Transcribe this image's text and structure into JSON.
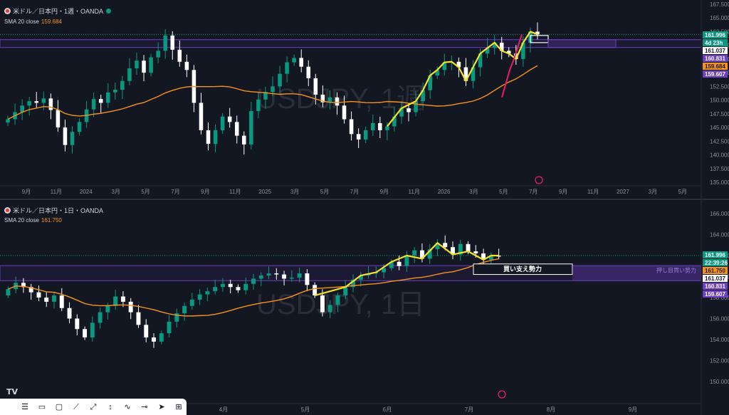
{
  "colors": {
    "bg": "#131722",
    "up": "#089981",
    "down": "#ffffff",
    "sma": "#f7931a",
    "trend": "#f5e02a",
    "pink": "#e91e63",
    "zone": "#6c3fc4",
    "axis_text": "#8a8f99"
  },
  "top": {
    "header": "米ドル／日本円・1週・OANDA",
    "sma_label": "SMA 20 close",
    "sma_value": "159.684",
    "watermark": "USDJPY, 1週",
    "y_ticks": [
      "167.500",
      "165.000",
      "162.500",
      "160.000",
      "157.500",
      "155.000",
      "152.500",
      "150.000",
      "147.500",
      "145.000",
      "142.500",
      "140.000",
      "137.500",
      "135.000"
    ],
    "x_ticks": [
      "9月",
      "11月",
      "2024",
      "3月",
      "5月",
      "7月",
      "9月",
      "11月",
      "2025",
      "3月",
      "5月",
      "7月",
      "9月",
      "11月",
      "2026",
      "3月",
      "5月",
      "7月",
      "9月",
      "11月",
      "2027",
      "3月",
      "5月"
    ],
    "price_tags": [
      {
        "text": "161.996",
        "bg": "#089981",
        "fg": "#ffffff"
      },
      {
        "text": "4d 23h",
        "bg": "#089981",
        "fg": "#ffffff"
      },
      {
        "text": "161.037",
        "bg": "#ffffff",
        "fg": "#131722"
      },
      {
        "text": "160.831",
        "bg": "#6c3fc4",
        "fg": "#ffffff"
      },
      {
        "text": "159.684",
        "bg": "#f7931a",
        "fg": "#131722"
      },
      {
        "text": "159.607",
        "bg": "#6c3fc4",
        "fg": "#ffffff"
      }
    ]
  },
  "bottom": {
    "header": "米ドル／日本円・1日・OANDA",
    "sma_label": "SMA 20 close",
    "sma_value": "161.750",
    "watermark": "USDJPY, 1日",
    "y_ticks": [
      "166.000",
      "164.000",
      "162.000",
      "160.000",
      "158.000",
      "156.000",
      "154.000",
      "152.000",
      "150.000"
    ],
    "x_ticks": [
      "4月",
      "5月",
      "6月",
      "7月",
      "8月",
      "9月"
    ],
    "zone_label": "買い支え勢力",
    "zone_right_label": "押し目買い勢力",
    "price_tags": [
      {
        "text": "161.996",
        "bg": "#089981",
        "fg": "#ffffff"
      },
      {
        "text": "22:39:26",
        "bg": "#089981",
        "fg": "#ffffff"
      },
      {
        "text": "161.750",
        "bg": "#f7931a",
        "fg": "#131722"
      },
      {
        "text": "161.037",
        "bg": "#ffffff",
        "fg": "#131722"
      },
      {
        "text": "160.831",
        "bg": "#6c3fc4",
        "fg": "#ffffff"
      },
      {
        "text": "159.607",
        "bg": "#6c3fc4",
        "fg": "#ffffff"
      }
    ]
  },
  "toolbar": {
    "icons": [
      "lines-icon",
      "text-icon",
      "rectangle-icon",
      "trendline-icon",
      "ruler-icon",
      "path-icon",
      "fib-icon",
      "brush-icon",
      "arrow-icon",
      "cursor-icon",
      "more-icon"
    ]
  },
  "chart_data": [
    {
      "type": "candlestick",
      "title": "米ドル／日本円・1週・OANDA",
      "ylim": [
        135,
        167.5
      ],
      "legend": "SMA 20 close 159.684",
      "series": [
        {
          "name": "price",
          "close_path": [
            146.5,
            147.8,
            149.0,
            149.8,
            149.5,
            150.3,
            148.2,
            145.0,
            141.8,
            144.2,
            146.0,
            148.3,
            150.2,
            149.5,
            151.4,
            151.9,
            153.5,
            155.8,
            157.2,
            155.0,
            157.8,
            159.0,
            161.8,
            159.2,
            157.0,
            155.5,
            149.5,
            144.5,
            142.0,
            144.5,
            147.0,
            146.0,
            143.5,
            141.9,
            148.0,
            150.1,
            151.5,
            152.5,
            154.8,
            156.9,
            157.7,
            156.1,
            154.0,
            151.0,
            149.6,
            150.5,
            149.0,
            146.5,
            143.8,
            142.8,
            144.5,
            145.8,
            144.5,
            145.2,
            147.0,
            148.5,
            147.8,
            149.8,
            151.8,
            154.5,
            155.5,
            156.9,
            157.0,
            156.0,
            153.5,
            156.0,
            158.5,
            159.5,
            160.5,
            159.0,
            158.5,
            157.5,
            160.5,
            162.5,
            161.996
          ]
        },
        {
          "name": "SMA 20 close",
          "last": 159.684
        }
      ],
      "levels": [
        161.037,
        160.831,
        159.607
      ]
    },
    {
      "type": "candlestick",
      "title": "米ドル／日本円・1日・OANDA",
      "ylim": [
        150,
        166
      ],
      "legend": "SMA 20 close 161.750",
      "series": [
        {
          "name": "price",
          "close_path": [
            158.8,
            159.4,
            159.0,
            158.5,
            158.0,
            157.6,
            158.2,
            157.0,
            156.0,
            155.0,
            154.2,
            155.6,
            156.6,
            157.2,
            158.1,
            157.6,
            156.6,
            155.4,
            154.2,
            153.8,
            154.6,
            155.7,
            156.5,
            157.2,
            157.8,
            158.3,
            158.6,
            159.0,
            159.3,
            159.0,
            158.7,
            159.3,
            159.8,
            160.1,
            160.3,
            160.2,
            159.8,
            159.9,
            160.3,
            159.2,
            158.2,
            156.6,
            157.3,
            158.2,
            159.0,
            159.7,
            160.1,
            160.3,
            160.4,
            160.8,
            161.4,
            161.0,
            162.0,
            162.5,
            161.7,
            162.6,
            163.2,
            162.8,
            162.1,
            163.1,
            162.4,
            162.2,
            161.6,
            162.0,
            161.996
          ]
        },
        {
          "name": "SMA 20 close",
          "last": 161.75
        }
      ],
      "levels": [
        161.037,
        160.831,
        159.607
      ],
      "annotations": [
        "買い支え勢力",
        "押し目買い勢力"
      ]
    }
  ]
}
